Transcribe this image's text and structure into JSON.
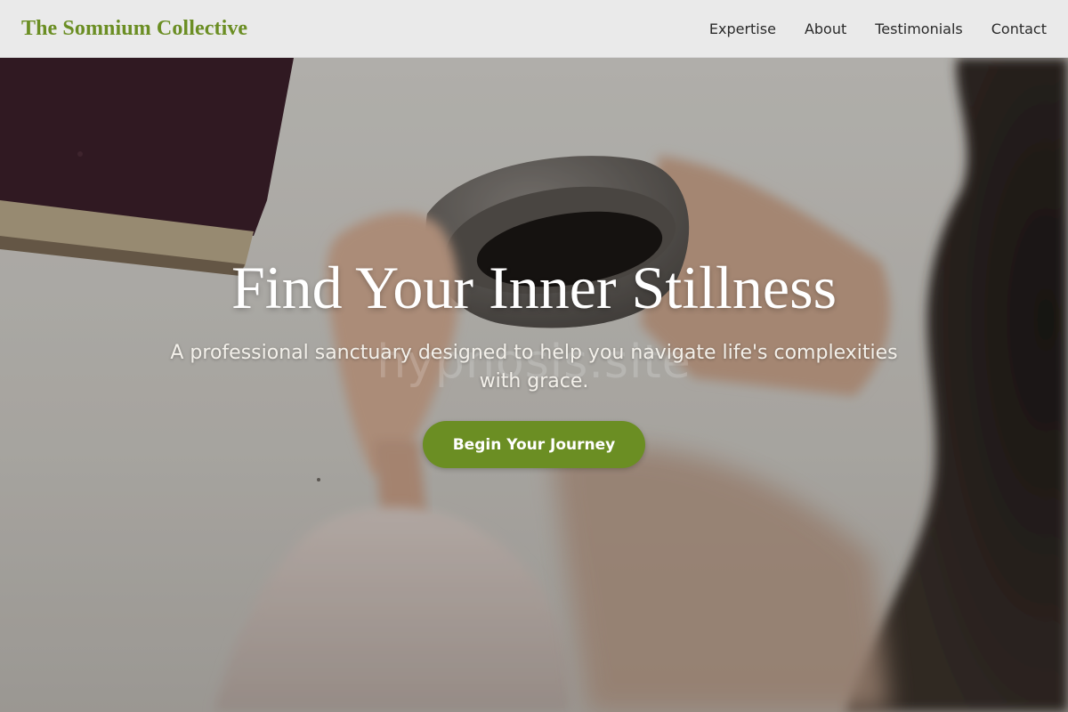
{
  "header": {
    "brand": "The Somnium Collective",
    "nav": [
      {
        "label": "Expertise"
      },
      {
        "label": "About"
      },
      {
        "label": "Testimonials"
      },
      {
        "label": "Contact"
      }
    ]
  },
  "hero": {
    "title": "Find Your Inner Stillness",
    "subtitle": "A professional sanctuary designed to help you navigate life's complexities with grace.",
    "cta_label": "Begin Your Journey",
    "watermark": "hypnosis.site"
  },
  "colors": {
    "accent": "#6b8e23",
    "header_bg": "#f1f1f1",
    "nav_text": "#2a2a2a"
  },
  "icons": {
    "background_photo": "hands-holding-coffee-mug-photo"
  }
}
